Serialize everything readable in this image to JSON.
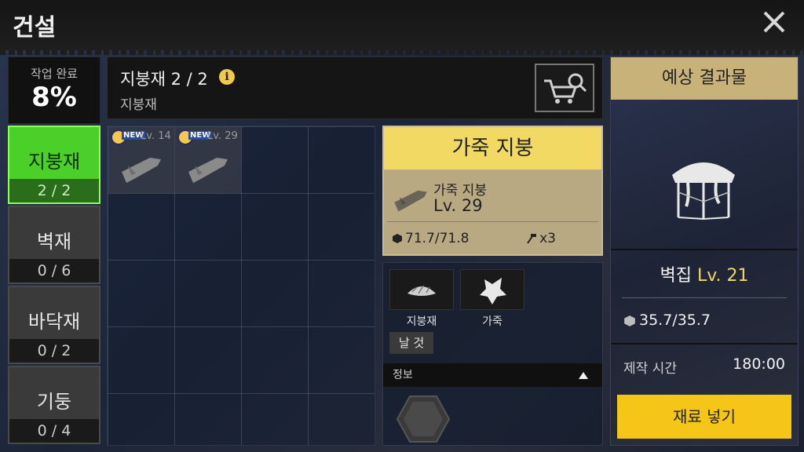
{
  "window": {
    "title": "건설",
    "close_icon": "close-icon"
  },
  "sidebar": {
    "progress_label": "작업 완료",
    "progress_value": "8%",
    "categories": [
      {
        "name": "지붕재",
        "count": "2 / 2",
        "active": true
      },
      {
        "name": "벽재",
        "count": "0 / 6",
        "active": false
      },
      {
        "name": "바닥재",
        "count": "0 / 2",
        "active": false
      },
      {
        "name": "기둥",
        "count": "0 / 4",
        "active": false
      }
    ]
  },
  "header": {
    "title": "지붕재 2 / 2",
    "info_icon": "i",
    "subtitle": "지붕재",
    "shop_icon": "cart-search-icon"
  },
  "inventory": {
    "slots": [
      {
        "badge": "NEW",
        "level": "Lv. 14"
      },
      {
        "badge": "NEW",
        "level": "Lv. 29"
      }
    ]
  },
  "detail": {
    "title": "가죽 지붕",
    "item_name": "가죽 지붕",
    "item_level": "Lv. 29",
    "durability": "71.7/71.8",
    "count": "x3"
  },
  "materials": {
    "items": [
      {
        "label": "지붕재"
      },
      {
        "label": "가죽"
      }
    ],
    "raw_label": "날 것",
    "info_label": "정보"
  },
  "result": {
    "title": "예상 결과물",
    "name": "벽집",
    "level": "Lv. 21",
    "durability": "35.7/35.7",
    "time_label": "제작 시간",
    "time_value": "180:00",
    "button_label": "재료 넣기"
  },
  "colors": {
    "accent_yellow": "#f5c518",
    "active_green": "#4bd02a",
    "card_title": "#f1d964"
  }
}
